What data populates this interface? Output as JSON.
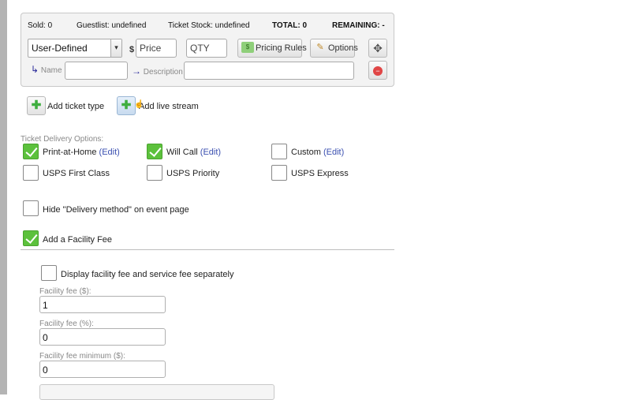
{
  "ticket": {
    "sold": "Sold: 0",
    "guestlist": "Guestlist: undefined",
    "stock": "Ticket Stock: undefined",
    "total": "TOTAL: 0",
    "remaining": "REMAINING: -",
    "type_value": "User-Defined",
    "currency": "$",
    "price_placeholder": "Price",
    "qty_placeholder": "QTY",
    "pricing_rules": "Pricing Rules",
    "options": "Options",
    "name_label": "Name",
    "description_label": "Description"
  },
  "actions": {
    "add_ticket_type": "Add ticket type",
    "add_live_stream": "Add live stream"
  },
  "delivery": {
    "heading": "Ticket Delivery Options:",
    "options": [
      {
        "label": "Print-at-Home",
        "edit": "(Edit)",
        "checked": true
      },
      {
        "label": "Will Call",
        "edit": "(Edit)",
        "checked": true
      },
      {
        "label": "Custom",
        "edit": "(Edit)",
        "checked": false
      },
      {
        "label": "USPS First Class",
        "checked": false
      },
      {
        "label": "USPS Priority",
        "checked": false
      },
      {
        "label": "USPS Express",
        "checked": false
      }
    ],
    "hide_method": {
      "label": "Hide \"Delivery method\" on event page",
      "checked": false
    }
  },
  "facility": {
    "add_fee": {
      "label": "Add a Facility Fee",
      "checked": true
    },
    "display_separately": {
      "label": "Display facility fee and service fee separately",
      "checked": false
    },
    "fee_dollar_label": "Facility fee ($):",
    "fee_dollar_value": "1",
    "fee_percent_label": "Facility fee (%):",
    "fee_percent_value": "0",
    "fee_min_label": "Facility fee minimum ($):",
    "fee_min_value": "0"
  },
  "colors": {
    "check_green": "#5cc13c",
    "link": "#3a4fb0"
  }
}
